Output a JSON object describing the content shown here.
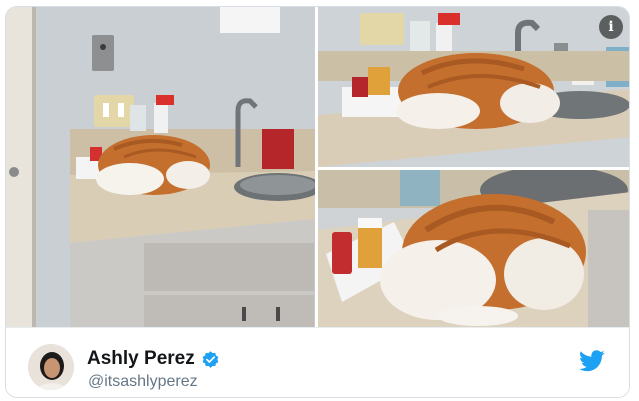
{
  "tweet": {
    "author_name": "Ashly Perez",
    "author_handle": "@itsashlyperez"
  },
  "photos": [
    {
      "name": "cat-on-counter-wide"
    },
    {
      "name": "cat-on-counter-side"
    },
    {
      "name": "cat-on-counter-closeup"
    }
  ],
  "icons": {
    "info": "info-icon",
    "verified": "verified-badge-icon",
    "brand": "twitter-bird-icon"
  },
  "colors": {
    "brand_blue": "#1da1f2",
    "name_text": "#14171a",
    "handle_text": "#657786"
  }
}
